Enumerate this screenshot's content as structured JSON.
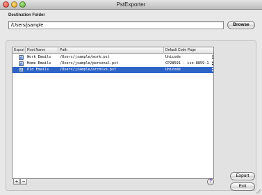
{
  "window": {
    "title": "PstExporter"
  },
  "destination": {
    "label": "Destination Folder",
    "path": "/Users/jsample",
    "browse_label": "Browse"
  },
  "table": {
    "headers": [
      "Export",
      "Root Name",
      "Path",
      "Default Code Page"
    ],
    "rows": [
      {
        "checked": true,
        "root_name": "Work Emails",
        "path": "/Users/jsample/work.pst",
        "code_page": "Unicode",
        "selected": false
      },
      {
        "checked": true,
        "root_name": "Home Emails",
        "path": "/Users/jsample/personal.pst",
        "code_page": "CP28591 - iso-8859-1",
        "selected": false
      },
      {
        "checked": true,
        "root_name": "Old Emails",
        "path": "/Users/jsample/archive.pst",
        "code_page": "Unicode",
        "selected": true
      }
    ]
  },
  "table_controls": {
    "add_label": "+",
    "remove_label": "−"
  },
  "actions": {
    "help_label": "?",
    "export_label": "Export",
    "exit_label": "Exit"
  },
  "glyphs": {
    "check": "✓",
    "stepper_up": "▲",
    "stepper_down": "▼"
  },
  "colors": {
    "selection": "#2f64c7"
  }
}
